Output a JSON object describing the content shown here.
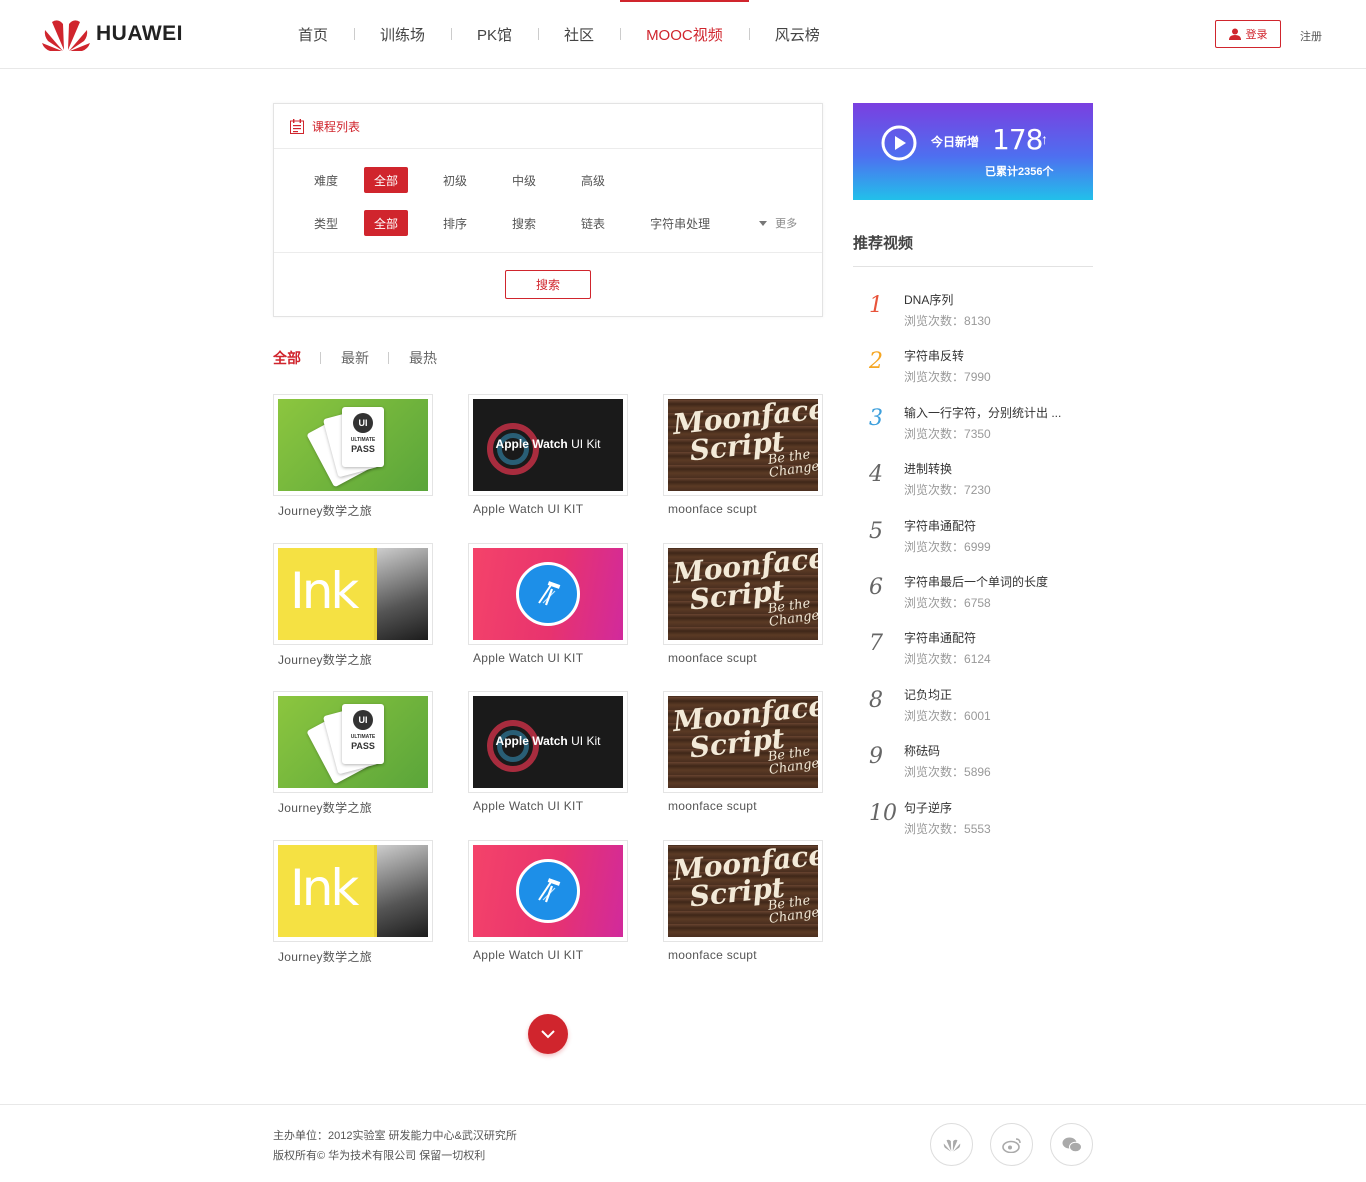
{
  "brand": {
    "logo_text": "HUAWEI",
    "accent": "#d0252d"
  },
  "nav": {
    "items": [
      {
        "label": "首页"
      },
      {
        "label": "训练场"
      },
      {
        "label": "PK馆"
      },
      {
        "label": "社区"
      },
      {
        "label": "MOOC视频"
      },
      {
        "label": "风云榜"
      }
    ],
    "active": "MOOC视频"
  },
  "auth": {
    "login_label": "登录",
    "register_label": "注册"
  },
  "filter": {
    "title": "课程列表",
    "difficulty_label": "难度",
    "difficulty_options": [
      "全部",
      "初级",
      "中级",
      "高级"
    ],
    "type_label": "类型",
    "type_options": [
      "全部",
      "排序",
      "搜索",
      "链表",
      "字符串处理"
    ],
    "more_label": "更多",
    "search_label": "搜索"
  },
  "sort_tabs": [
    "全部",
    "最新",
    "最热"
  ],
  "courses": [
    {
      "title": "Journey数学之旅",
      "thumb": "ui-pass"
    },
    {
      "title": "Apple Watch UI KIT",
      "thumb": "apple-watch"
    },
    {
      "title": "moonface scupt",
      "thumb": "moonface"
    },
    {
      "title": "Journey数学之旅",
      "thumb": "ink"
    },
    {
      "title": "Apple Watch UI KIT",
      "thumb": "xcode"
    },
    {
      "title": "moonface scupt",
      "thumb": "moonface"
    },
    {
      "title": "Journey数学之旅",
      "thumb": "ui-pass"
    },
    {
      "title": "Apple Watch UI KIT",
      "thumb": "apple-watch"
    },
    {
      "title": "moonface scupt",
      "thumb": "moonface"
    },
    {
      "title": "Journey数学之旅",
      "thumb": "ink"
    },
    {
      "title": "Apple Watch UI KIT",
      "thumb": "xcode"
    },
    {
      "title": "moonface scupt",
      "thumb": "moonface"
    }
  ],
  "thumb_text": {
    "apple_watch_bold": "Apple Watch",
    "apple_watch_light": "UI Kit",
    "ink": "Ink",
    "moonface_line1": "Moonface",
    "moonface_line2": "Script",
    "moonface_tag": "Be the Change",
    "ui_badge": "UI",
    "pass_line1": "ULTIMATE",
    "pass_line2": "PASS"
  },
  "stats": {
    "today_label": "今日新增",
    "today_count": "178",
    "arrow": "↑",
    "total_label": "已累计2356个"
  },
  "recommend": {
    "title": "推荐视频",
    "views_prefix": "浏览次数：",
    "items": [
      {
        "rank": "1",
        "name": "DNA序列",
        "views": "8130",
        "color": "#e8543b"
      },
      {
        "rank": "2",
        "name": "字符串反转",
        "views": "7990",
        "color": "#f5a623"
      },
      {
        "rank": "3",
        "name": "输入一行字符，分别统计出 ...",
        "views": "7350",
        "color": "#3d9fdc"
      },
      {
        "rank": "4",
        "name": "进制转换",
        "views": "7230",
        "color": "#666666"
      },
      {
        "rank": "5",
        "name": "字符串通配符",
        "views": "6999",
        "color": "#666666"
      },
      {
        "rank": "6",
        "name": "字符串最后一个单词的长度",
        "views": "6758",
        "color": "#666666"
      },
      {
        "rank": "7",
        "name": "字符串通配符",
        "views": "6124",
        "color": "#666666"
      },
      {
        "rank": "8",
        "name": "记负均正",
        "views": "6001",
        "color": "#666666"
      },
      {
        "rank": "9",
        "name": "称砝码",
        "views": "5896",
        "color": "#666666"
      },
      {
        "rank": "10",
        "name": "句子逆序",
        "views": "5553",
        "color": "#666666"
      }
    ]
  },
  "footer": {
    "line1": "主办单位：2012实验室 研发能力中心&武汉研究所",
    "line2": "版权所有© 华为技术有限公司 保留一切权利",
    "social": [
      "huawei-icon",
      "weibo-icon",
      "wechat-icon"
    ]
  }
}
